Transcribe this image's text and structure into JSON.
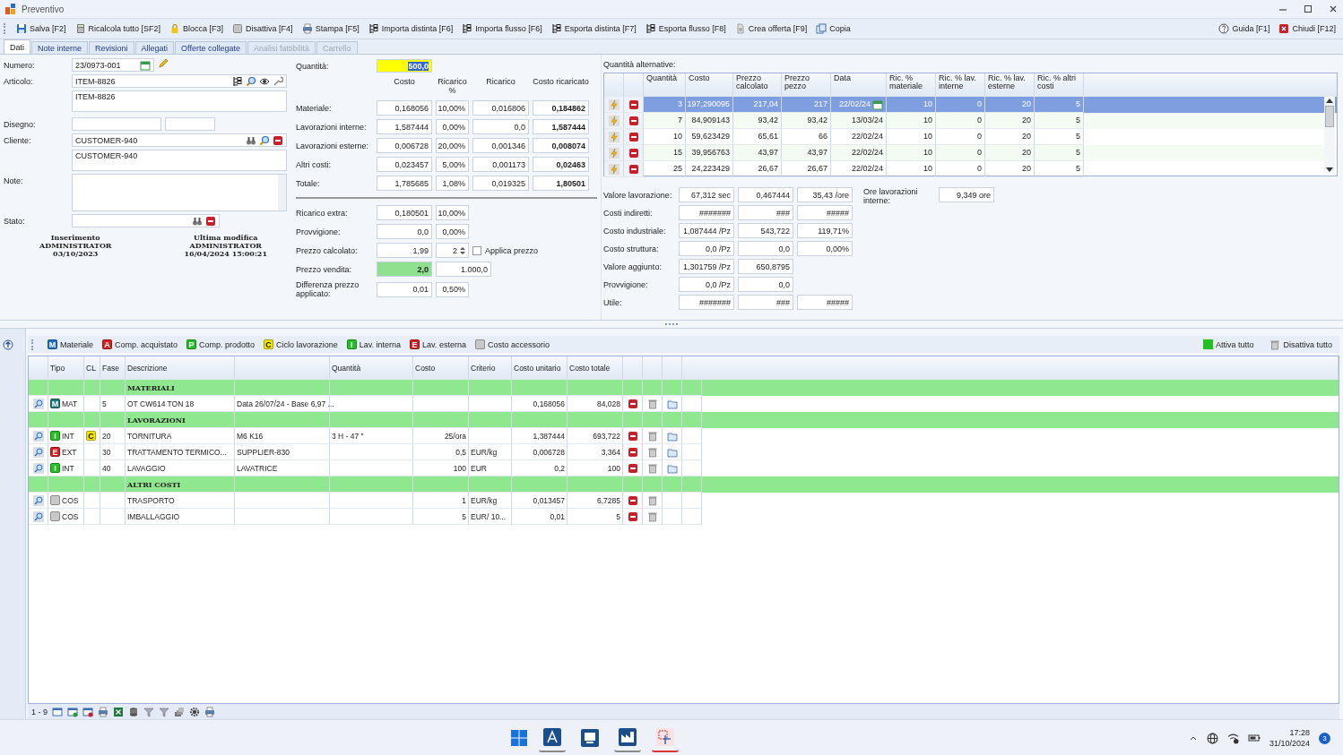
{
  "window": {
    "title": "Preventivo"
  },
  "toolbar": {
    "left": [
      "Salva [F2]",
      "Ricalcola tutto [SF2]",
      "Blocca [F3]",
      "Disattiva [F4]",
      "Stampa [F5]",
      "Importa distinta [F6]",
      "Importa flusso [F6]",
      "Esporta distinta [F7]",
      "Esporta flusso [F8]",
      "Crea offerta [F9]",
      "Copia"
    ],
    "right": [
      "Guida [F1]",
      "Chiudi [F12]"
    ]
  },
  "tabs": [
    {
      "label": "Dati",
      "selected": true,
      "disabled": false
    },
    {
      "label": "Note interne",
      "selected": false,
      "disabled": false
    },
    {
      "label": "Revisioni",
      "selected": false,
      "disabled": false
    },
    {
      "label": "Allegati",
      "selected": false,
      "disabled": false
    },
    {
      "label": "Offerte collegate",
      "selected": false,
      "disabled": false
    },
    {
      "label": "Analisi fattibilità",
      "selected": false,
      "disabled": true
    },
    {
      "label": "Carrello",
      "selected": false,
      "disabled": true
    }
  ],
  "header": {
    "numero": {
      "label": "Numero:",
      "value": "23/0973-001"
    },
    "articolo": {
      "label": "Articolo:",
      "code": "ITEM-8826",
      "description": "ITEM-8826"
    },
    "disegno": {
      "label": "Disegno:"
    },
    "cliente": {
      "label": "Cliente:",
      "code": "CUSTOMER-940",
      "description": "CUSTOMER-940"
    },
    "note": {
      "label": "Note:"
    },
    "stato": {
      "label": "Stato:"
    },
    "audit": [
      {
        "title": "Inserimento",
        "user": "ADMINISTRATOR",
        "date": "03/10/2023"
      },
      {
        "title": "Ultima modifica",
        "user": "ADMINISTRATOR",
        "date": "16/04/2024 15:00:21"
      }
    ]
  },
  "costs": {
    "quantity": {
      "label": "Quantità:",
      "value": "500,0"
    },
    "columns": [
      "Costo",
      "Ricarico %",
      "Ricarico",
      "Costo ricaricato"
    ],
    "rows": [
      {
        "label": "Materiale:",
        "values": [
          "0,168056",
          "10,00%",
          "0,016806",
          "0,184862"
        ]
      },
      {
        "label": "Lavorazioni interne:",
        "values": [
          "1,587444",
          "0,00%",
          "0,0",
          "1,587444"
        ]
      },
      {
        "label": "Lavorazioni esterne:",
        "values": [
          "0,006728",
          "20,00%",
          "0,001346",
          "0,008074"
        ]
      },
      {
        "label": "Altri costi:",
        "values": [
          "0,023457",
          "5,00%",
          "0,001173",
          "0,02463"
        ]
      },
      {
        "label": "Totale:",
        "values": [
          "1,785685",
          "1,08%",
          "0,019325",
          "1,80501"
        ]
      }
    ],
    "extra": [
      {
        "kind": "plain",
        "label": "Ricarico extra:",
        "values": [
          "0,180501",
          "10,00%"
        ]
      },
      {
        "kind": "plain",
        "label": "Provvigione:",
        "values": [
          "0,0",
          "0,00%"
        ]
      },
      {
        "kind": "spinner",
        "label": "Prezzo calcolato:",
        "values": [
          "1,99",
          "2"
        ],
        "option": {
          "label": "Applica prezzo",
          "checked": false
        }
      },
      {
        "kind": "highlight",
        "label": "Prezzo vendita:",
        "values": [
          "2,0",
          "1.000,0"
        ]
      },
      {
        "kind": "plain",
        "label": "Differenza prezzo applicato:",
        "values": [
          "0,01",
          "0,50%"
        ]
      }
    ]
  },
  "alternatives": {
    "title": "Quantità alternative:",
    "columns": [
      "Quantità",
      "Costo",
      "Prezzo calcolato",
      "Prezzo pezzo",
      "Data",
      "Ric. % materiale",
      "Ric. % lav. interne",
      "Ric. % lav. esterne",
      "Ric. % altri costi"
    ],
    "rows": [
      {
        "selected": true,
        "cells": [
          "3",
          "197,290095",
          "217,04",
          "217",
          "22/02/24",
          "10",
          "0",
          "20",
          "5"
        ]
      },
      {
        "selected": false,
        "cells": [
          "7",
          "84,909143",
          "93,42",
          "93,42",
          "13/03/24",
          "10",
          "0",
          "20",
          "5"
        ]
      },
      {
        "selected": false,
        "cells": [
          "10",
          "59,623429",
          "65,61",
          "66",
          "22/02/24",
          "10",
          "0",
          "20",
          "5"
        ]
      },
      {
        "selected": false,
        "cells": [
          "15",
          "39,956763",
          "43,97",
          "43,97",
          "22/02/24",
          "10",
          "0",
          "20",
          "5"
        ]
      },
      {
        "selected": false,
        "cells": [
          "25",
          "24,223429",
          "26,67",
          "26,67",
          "22/02/24",
          "10",
          "0",
          "20",
          "5"
        ]
      }
    ]
  },
  "analysis": {
    "rows": [
      {
        "label": "Valore lavorazione:",
        "values": [
          "67,312 sec",
          "0,467444",
          "35,43 /ore"
        ]
      },
      {
        "label": "Costi indiretti:",
        "values": [
          "#######",
          "###",
          "#####"
        ]
      },
      {
        "label": "Costo industriale:",
        "values": [
          "1,087444 /Pz",
          "543,722",
          "119,71%"
        ]
      },
      {
        "label": "Costo struttura:",
        "values": [
          "0,0 /Pz",
          "0,0",
          "0,00%"
        ]
      },
      {
        "label": "Valore aggiunto:",
        "values": [
          "1,301759 /Pz",
          "650,8795"
        ]
      },
      {
        "label": "Provvigione:",
        "values": [
          "0,0 /Pz",
          "0,0"
        ]
      },
      {
        "label": "Utile:",
        "values": [
          "#######",
          "###",
          "#####"
        ]
      }
    ],
    "hours": {
      "label": "Ore lavorazioni interne:",
      "value": "9,349 ore"
    }
  },
  "components": {
    "legend": [
      {
        "letter": "M",
        "label": "Materiale",
        "color": "#1f6fc5"
      },
      {
        "letter": "A",
        "label": "Comp. acquistato",
        "color": "#d42020"
      },
      {
        "letter": "P",
        "label": "Comp. prodotto",
        "color": "#22c022"
      },
      {
        "letter": "C",
        "label": "Ciclo lavorazione",
        "color": "#f5e600"
      },
      {
        "letter": "I",
        "label": "Lav. interna",
        "color": "#22c022"
      },
      {
        "letter": "E",
        "label": "Lav. esterna",
        "color": "#d42020"
      },
      {
        "label": "Costo accessorio",
        "color": "#c8c8c8"
      }
    ],
    "actions": [
      "Attiva tutto",
      "Disattiva tutto"
    ],
    "columns": [
      "Tipo",
      "CL",
      "Fase",
      "Descrizione",
      "Quantità",
      "Costo",
      "Criterio",
      "Costo unitario",
      "Costo totale"
    ],
    "rows": [
      {
        "kind": "group",
        "label": "MATERIALI"
      },
      {
        "kind": "item",
        "badge": {
          "letter": "M",
          "color": "#1e7a78"
        },
        "type": "MAT",
        "phase": "5",
        "description": "OT CW614 TON 18",
        "detail": "Data 26/07/24 - Base 6,97 ...",
        "unit_cost": "0,168056",
        "total": "84,028",
        "copy": true
      },
      {
        "kind": "group",
        "label": "LAVORAZIONI"
      },
      {
        "kind": "item",
        "badge": {
          "letter": "I",
          "color": "#22c022"
        },
        "type": "INT",
        "cl": {
          "letter": "C",
          "color": "#f5e600"
        },
        "phase": "20",
        "description": "TORNITURA",
        "detail": "M6 K16",
        "quantity": "3 H - 47 \"",
        "cost": "25/ora",
        "unit_cost": "1,387444",
        "total": "693,722",
        "copy": true
      },
      {
        "kind": "item",
        "badge": {
          "letter": "E",
          "color": "#d42020"
        },
        "type": "EXT",
        "phase": "30",
        "description": "TRATTAMENTO TERMICO...",
        "detail": "SUPPLIER-830",
        "cost": "0,5",
        "criterion": "EUR/kg",
        "unit_cost": "0,006728",
        "total": "3,364",
        "copy": true
      },
      {
        "kind": "item",
        "badge": {
          "letter": "I",
          "color": "#22c022"
        },
        "type": "INT",
        "phase": "40",
        "description": "LAVAGGIO",
        "detail": "LAVATRICE",
        "cost": "100",
        "criterion": "EUR",
        "unit_cost": "0,2",
        "total": "100",
        "copy": true
      },
      {
        "kind": "group",
        "label": "ALTRI COSTI"
      },
      {
        "kind": "item",
        "badge": {
          "color": "#c8c8c8"
        },
        "type": "COS",
        "description": "TRASPORTO",
        "cost": "1",
        "criterion": "EUR/kg",
        "unit_cost": "0,013457",
        "total": "6,7285",
        "copy": false
      },
      {
        "kind": "item",
        "badge": {
          "color": "#c8c8c8"
        },
        "type": "COS",
        "description": "IMBALLAGGIO",
        "cost": "5",
        "criterion": "EUR/ 10...",
        "unit_cost": "0,01",
        "total": "5",
        "copy": false
      }
    ]
  },
  "status": {
    "range": "1 - 9"
  },
  "taskbar": {
    "time": "17:28",
    "date": "31/10/2024",
    "notifications": "3"
  }
}
